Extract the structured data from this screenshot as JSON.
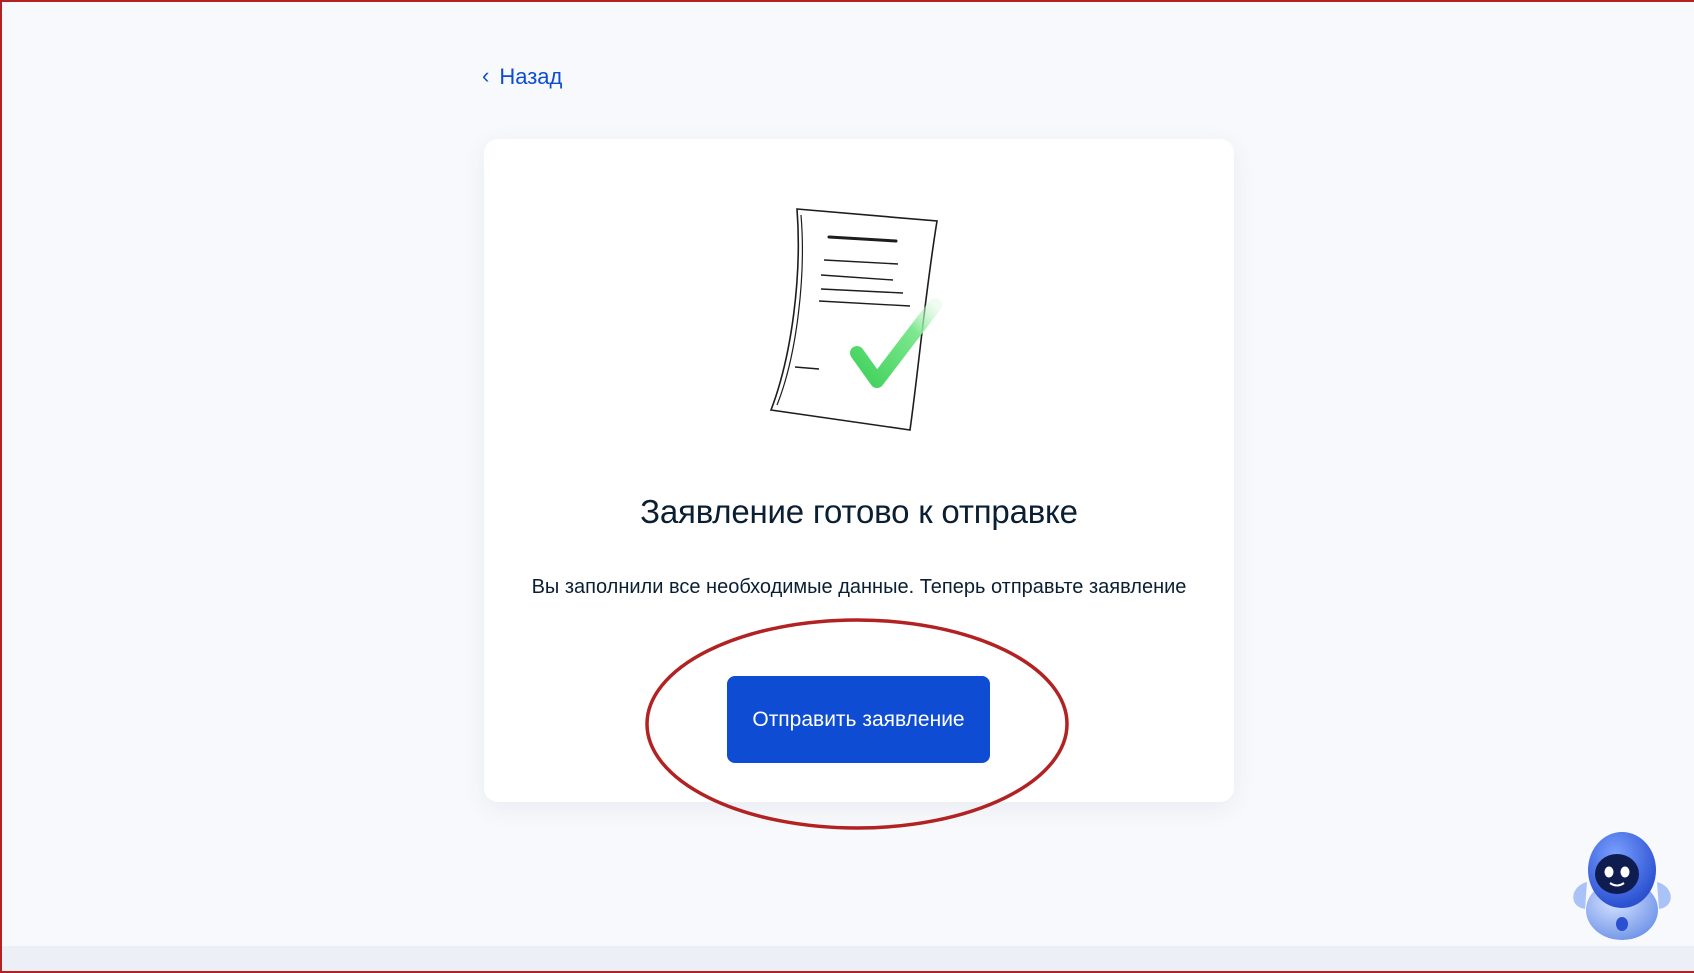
{
  "navigation": {
    "back_label": "Назад"
  },
  "card": {
    "title": "Заявление готово к отправке",
    "description": "Вы заполнили все необходимые данные. Теперь отправьте заявление",
    "submit_label": "Отправить заявление"
  },
  "icons": {
    "back": "chevron-left-icon",
    "illustration": "document-checkmark-icon",
    "assistant": "robot-assistant-icon"
  },
  "colors": {
    "accent": "#0d4cd3",
    "highlight": "#b22222",
    "check": "#4cd964",
    "text": "#0b1f33"
  }
}
